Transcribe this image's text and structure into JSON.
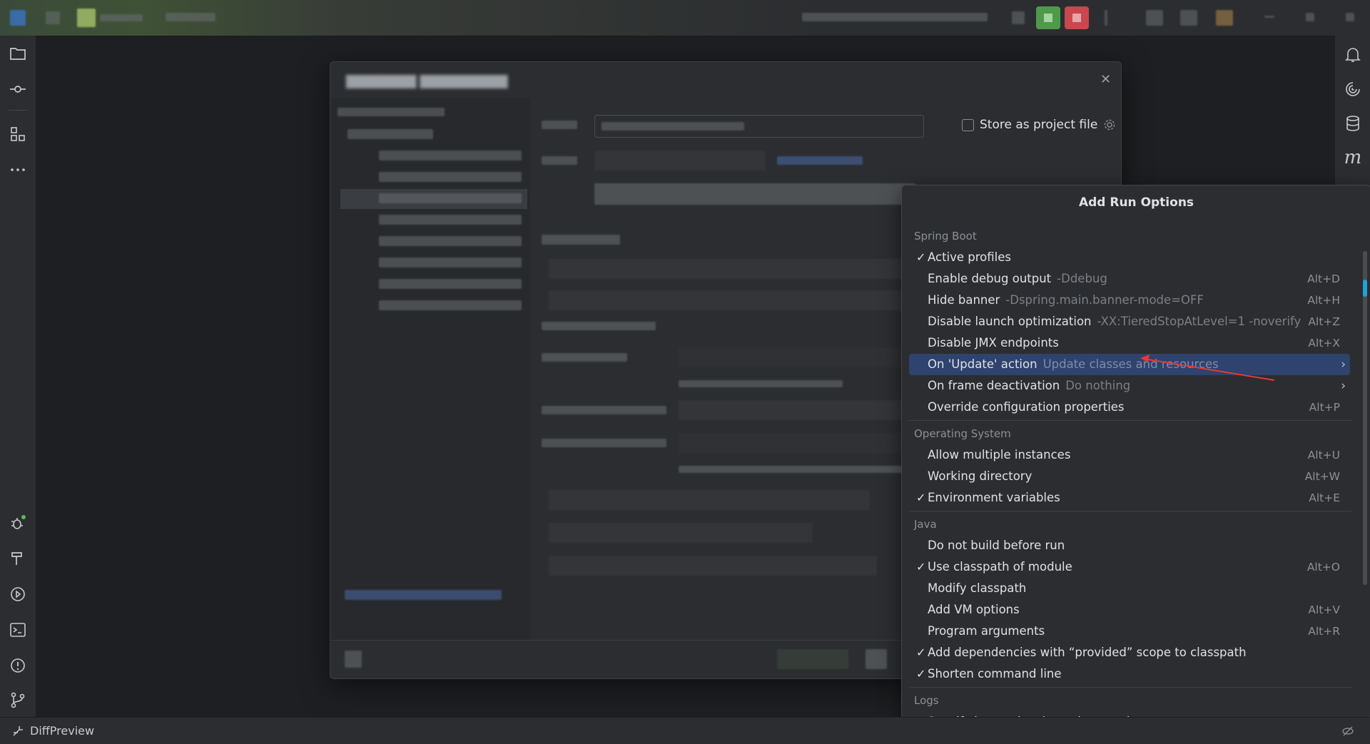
{
  "status_bar": {
    "diff_preview": "DiffPreview"
  },
  "dialog": {
    "store_label": "Store as project file"
  },
  "popup": {
    "title": "Add Run Options",
    "sections": [
      {
        "name": "Spring Boot",
        "items": [
          {
            "label": "Active profiles",
            "hint": "",
            "shortcut": "",
            "checked": true,
            "submenu": false,
            "selected": false
          },
          {
            "label": "Enable debug output",
            "hint": "-Ddebug",
            "shortcut": "Alt+D",
            "checked": false,
            "submenu": false,
            "selected": false
          },
          {
            "label": "Hide banner",
            "hint": "-Dspring.main.banner-mode=OFF",
            "shortcut": "Alt+H",
            "checked": false,
            "submenu": false,
            "selected": false
          },
          {
            "label": "Disable launch optimization",
            "hint": "-XX:TieredStopAtLevel=1 -noverify",
            "shortcut": "Alt+Z",
            "checked": false,
            "submenu": false,
            "selected": false
          },
          {
            "label": "Disable JMX endpoints",
            "hint": "",
            "shortcut": "Alt+X",
            "checked": false,
            "submenu": false,
            "selected": false
          },
          {
            "label": "On 'Update' action",
            "hint": "Update classes and resources",
            "shortcut": "",
            "checked": false,
            "submenu": true,
            "selected": true
          },
          {
            "label": "On frame deactivation",
            "hint": "Do nothing",
            "shortcut": "",
            "checked": false,
            "submenu": true,
            "selected": false
          },
          {
            "label": "Override configuration properties",
            "hint": "",
            "shortcut": "Alt+P",
            "checked": false,
            "submenu": false,
            "selected": false
          }
        ]
      },
      {
        "name": "Operating System",
        "items": [
          {
            "label": "Allow multiple instances",
            "hint": "",
            "shortcut": "Alt+U",
            "checked": false,
            "submenu": false,
            "selected": false
          },
          {
            "label": "Working directory",
            "hint": "",
            "shortcut": "Alt+W",
            "checked": false,
            "submenu": false,
            "selected": false
          },
          {
            "label": "Environment variables",
            "hint": "",
            "shortcut": "Alt+E",
            "checked": true,
            "submenu": false,
            "selected": false
          }
        ]
      },
      {
        "name": "Java",
        "items": [
          {
            "label": "Do not build before run",
            "hint": "",
            "shortcut": "",
            "checked": false,
            "submenu": false,
            "selected": false
          },
          {
            "label": "Use classpath of module",
            "hint": "",
            "shortcut": "Alt+O",
            "checked": true,
            "submenu": false,
            "selected": false
          },
          {
            "label": "Modify classpath",
            "hint": "",
            "shortcut": "",
            "checked": false,
            "submenu": false,
            "selected": false
          },
          {
            "label": "Add VM options",
            "hint": "",
            "shortcut": "Alt+V",
            "checked": false,
            "submenu": false,
            "selected": false
          },
          {
            "label": "Program arguments",
            "hint": "",
            "shortcut": "Alt+R",
            "checked": false,
            "submenu": false,
            "selected": false
          },
          {
            "label": "Add dependencies with “provided” scope to classpath",
            "hint": "",
            "shortcut": "",
            "checked": true,
            "submenu": false,
            "selected": false
          },
          {
            "label": "Shorten command line",
            "hint": "",
            "shortcut": "",
            "checked": true,
            "submenu": false,
            "selected": false
          }
        ]
      },
      {
        "name": "Logs",
        "items": [
          {
            "label": "Specify logs to be shown in console",
            "hint": "",
            "shortcut": "",
            "checked": false,
            "submenu": false,
            "selected": false
          }
        ]
      }
    ]
  },
  "colors": {
    "selection": "#2e436e",
    "accent_scroll": "#1fa3d8",
    "annotation": "#e53935"
  }
}
